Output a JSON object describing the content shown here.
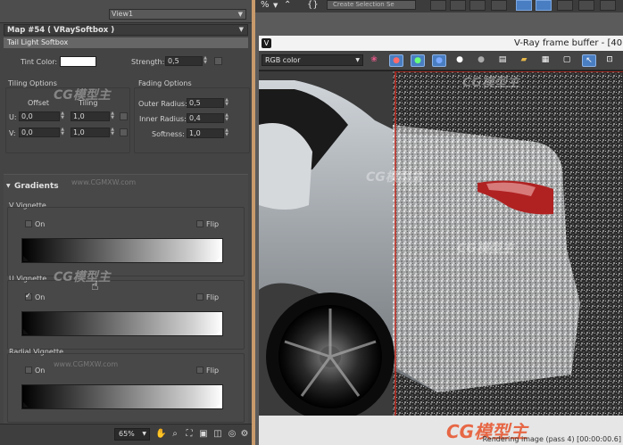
{
  "material_editor": {
    "view_select": "View1",
    "map_title": "Map #54  ( VRaySoftbox )",
    "section_title": "Tail Light Softbox",
    "tint_color_label": "Tint Color:",
    "tint_color": "#ffffff",
    "strength_label": "Strength:",
    "strength_value": "0,5",
    "tiling": {
      "title": "Tiling Options",
      "offset_header": "Offset",
      "tiling_header": "Tiling",
      "u_label": "U:",
      "v_label": "V:",
      "u_offset": "0,0",
      "u_tiling": "1,0",
      "v_offset": "0,0",
      "v_tiling": "1,0"
    },
    "fading": {
      "title": "Fading Options",
      "outer_radius_label": "Outer Radius:",
      "outer_radius": "0,5",
      "inner_radius_label": "Inner Radius:",
      "inner_radius": "0,4",
      "softness_label": "Softness:",
      "softness": "1,0"
    },
    "gradients": {
      "title": "Gradients",
      "v_vignette": {
        "title": "V Vignette",
        "on_label": "On",
        "flip_label": "Flip",
        "on": false,
        "flip": false
      },
      "u_vignette": {
        "title": "U Vignette",
        "on_label": "On",
        "flip_label": "Flip",
        "on": true,
        "flip": false
      },
      "radial_vignette": {
        "title": "Radial Vignette",
        "on_label": "On",
        "flip_label": "Flip",
        "on": false,
        "flip": false
      }
    },
    "zoom": "65%"
  },
  "top_toolbar": {
    "percent_label": "%",
    "field_text": "Create Selection Se"
  },
  "frame_buffer": {
    "title": "V-Ray frame buffer - [40",
    "channel": "RGB color",
    "status": "Rendering image (pass 4) [00:00:00.6]"
  },
  "watermarks": {
    "brand": "CG模型主",
    "url": "www.CGMXW.com"
  },
  "colors": {
    "accent_blue": "#4a7ec2",
    "panel_border": "#c89a6c",
    "render_region": "#c0281e"
  }
}
